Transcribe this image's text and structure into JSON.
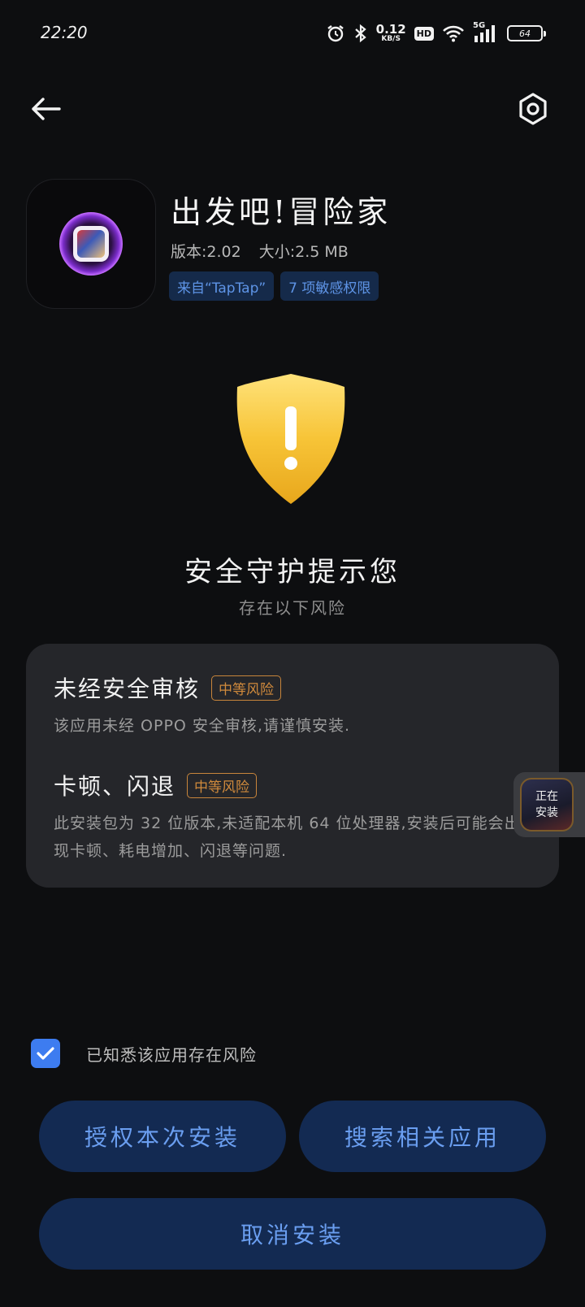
{
  "status_bar": {
    "time": "22:20",
    "net_speed_value": "0.12",
    "net_speed_unit": "KB/S",
    "hd_label": "HD",
    "signal_label": "5G",
    "battery_level": "64",
    "icons": [
      "alarm-icon",
      "bluetooth-icon",
      "wifi-icon",
      "signal-icon",
      "battery-icon"
    ]
  },
  "header": {
    "back_icon": "back-arrow-icon",
    "settings_icon": "settings-hexagon-icon"
  },
  "app": {
    "name": "出发吧!冒险家",
    "version": "版本:2.02",
    "size": "大小:2.5 MB",
    "tags": [
      "来自“TapTap”",
      "7 项敏感权限"
    ]
  },
  "warning": {
    "title": "安全守护提示您",
    "subtitle": "存在以下风险"
  },
  "risks": [
    {
      "title": "未经安全审核",
      "level": "中等风险",
      "description": "该应用未经 OPPO 安全审核,请谨慎安装."
    },
    {
      "title": "卡顿、闪退",
      "level": "中等风险",
      "description": "此安装包为 32 位版本,未适配本机 64 位处理器,安装后可能会出现卡顿、耗电增加、闪退等问题."
    }
  ],
  "floating_widget": {
    "line1": "正在",
    "line2": "安装"
  },
  "agree": {
    "checked": true,
    "label": "已知悉该应用存在风险"
  },
  "buttons": {
    "authorize": "授权本次安装",
    "search": "搜索相关应用",
    "cancel": "取消安装"
  },
  "colors": {
    "background": "#0d0e10",
    "card": "#25262a",
    "button_bg": "#132a52",
    "button_text": "#6a9ef0",
    "tag_bg": "#152a4a",
    "tag_text": "#5e94e6",
    "risk_badge": "#d08a3c",
    "shield": "#f5c33b",
    "checkbox": "#3d7cf0"
  }
}
